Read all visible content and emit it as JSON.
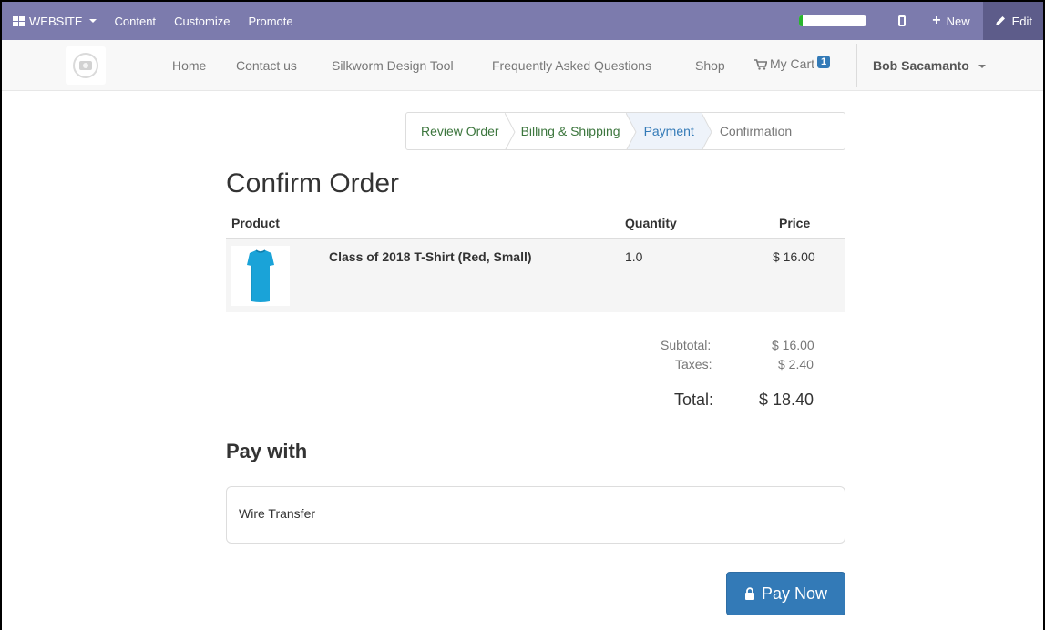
{
  "adminbar": {
    "website_label": "WEBSITE",
    "menu": [
      "Content",
      "Customize",
      "Promote"
    ],
    "progress_fraction": 0.05,
    "new_label": "New",
    "edit_label": "Edit",
    "bg_color": "#7c7bad",
    "progress_color": "#28b62c"
  },
  "navbar": {
    "links": {
      "home": "Home",
      "contact": "Contact us",
      "silkworm": "Silkworm Design Tool",
      "faq": "Frequently Asked Questions",
      "shop": "Shop"
    },
    "cart_label": "My Cart",
    "cart_count": "1",
    "user_name": "Bob Sacamanto"
  },
  "wizard": {
    "steps": [
      "Review Order",
      "Billing & Shipping",
      "Payment",
      "Confirmation"
    ],
    "active_step": "Payment"
  },
  "order": {
    "title": "Confirm Order",
    "columns": {
      "product": "Product",
      "quantity": "Quantity",
      "price": "Price"
    },
    "items": [
      {
        "name": "Class of 2018 T-Shirt (Red, Small)",
        "quantity": "1.0",
        "price": "$ 16.00",
        "image": "tshirt-blue"
      }
    ],
    "subtotal_label": "Subtotal:",
    "subtotal_value": "$ 16.00",
    "taxes_label": "Taxes:",
    "taxes_value": "$ 2.40",
    "total_label": "Total:",
    "total_value": "$ 18.40"
  },
  "payment": {
    "title": "Pay with",
    "method": "Wire Transfer",
    "button_label": "Pay Now",
    "button_color": "#337ab7"
  }
}
